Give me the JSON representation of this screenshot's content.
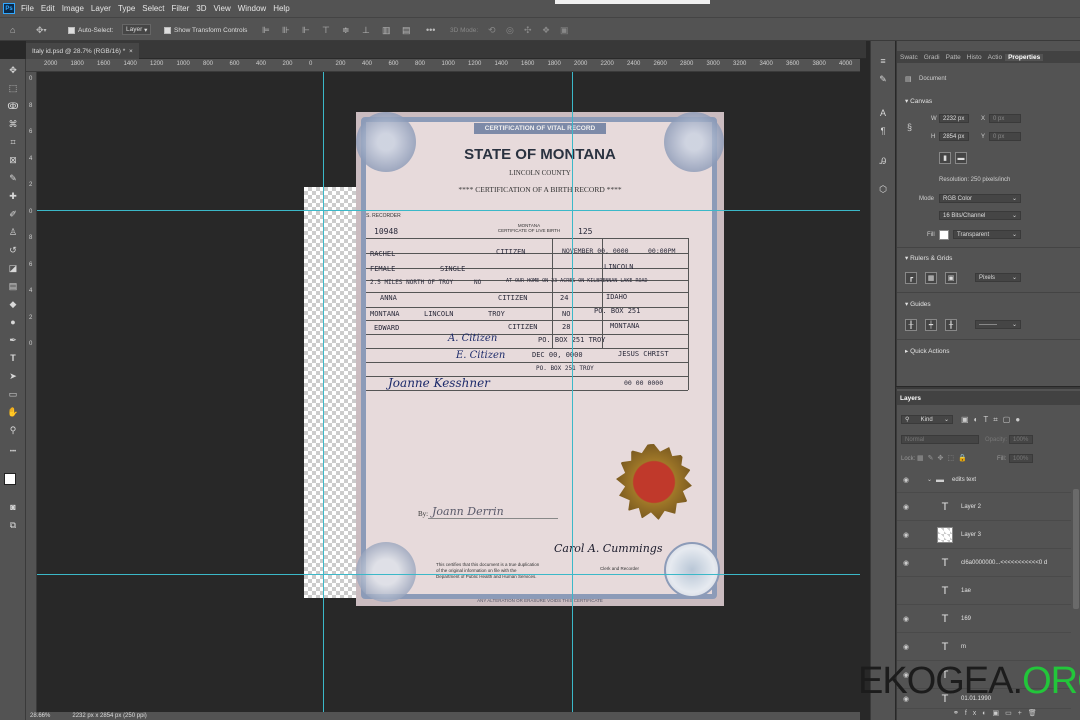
{
  "app": {
    "logo": "Ps"
  },
  "menu": [
    "File",
    "Edit",
    "Image",
    "Layer",
    "Type",
    "Select",
    "Filter",
    "3D",
    "View",
    "Window",
    "Help"
  ],
  "options": {
    "auto_select": "Auto-Select:",
    "auto_select_target": "Layer",
    "show_transform": "Show Transform Controls",
    "mode_3d": "3D Mode:"
  },
  "tab": {
    "title": "Italy id.psd @ 28.7% (RGB/16) *",
    "close": "×"
  },
  "ruler": {
    "h": [
      "2000",
      "1800",
      "1600",
      "1400",
      "1200",
      "1000",
      "800",
      "600",
      "400",
      "200",
      "0",
      "200",
      "400",
      "600",
      "800",
      "1000",
      "1200",
      "1400",
      "1600",
      "1800",
      "2000",
      "2200",
      "2400",
      "2600",
      "2800",
      "3000",
      "3200",
      "3400",
      "3600",
      "3800",
      "4000",
      "42"
    ],
    "v": [
      "0",
      "8",
      "6",
      "4",
      "2",
      "0",
      "8",
      "6",
      "4",
      "2",
      "0"
    ]
  },
  "status": {
    "zoom": "28.66%",
    "size": "2232 px x 2854 px (250 ppi)"
  },
  "document": {
    "band": "CERTIFICATION OF VITAL RECORD",
    "state": "STATE OF MONTANA",
    "county": "LINCOLN COUNTY",
    "type": "**** CERTIFICATION OF A BIRTH RECORD ****",
    "recorder": "S. RECORDER",
    "number": "10948",
    "center_head": "MONTANA\nCERTIFICATE OF LIVE BIRTH",
    "cert_no": "125",
    "first_name": "RACHEL",
    "surname": "CITIZEN",
    "birth_date": "NOVEMBER 00, 0000",
    "birth_time": "00:00PM",
    "sex": "FEMALE",
    "plurality": "SINGLE",
    "county_birth": "LINCOLN",
    "place": "2.5 MILES NORTH OF TROY",
    "inside": "NO",
    "place2": "AT OUR HOME ON 23 ACRES ON KILBRENNAN LAKE ROAD",
    "mother_first": "ANNA",
    "mother_last": "CITIZEN",
    "mother_age": "24",
    "mother_state": "IDAHO",
    "res_state": "MONTANA",
    "res_county": "LINCOLN",
    "res_city": "TROY",
    "res_inside": "NO",
    "res_box": "PO. BOX 251",
    "father_first": "EDWARD",
    "father_last": "CITIZEN",
    "father_age": "28",
    "father_state": "MONTANA",
    "informant_sig": "A. Citizen",
    "informant_addr": "PO. BOX 251 TROY",
    "cert_date": "DEC 00, 0000",
    "attendant": "JESUS CHRIST",
    "attendant_sig": "E. Citizen",
    "attendant_addr": "PO. BOX 251 TROY",
    "registrar_sig": "Joanne Kesshner",
    "filed_date": "00 00 0000",
    "by_label": "By:",
    "by_sig": "Joann Derrin",
    "footer1": "This certifies that this document is a true duplication",
    "footer2": "of the original information on file with the",
    "footer3": "Department of Public Health and Human Services.",
    "clerk_sig": "Carol A. Cummings",
    "clerk_title": "Clerk and Recorder",
    "bottom": "ANY ALTERATION OR ERASURE VOIDS THIS CERTIFICATE"
  },
  "right_panel": {
    "tabs": [
      "Swatc",
      "Gradi",
      "Patte",
      "Histo",
      "Actio",
      "Properties"
    ],
    "doc_label": "Document",
    "canvas_title": "Canvas",
    "w_label": "W",
    "w_value": "2232 px",
    "x_label": "X",
    "x_value": "0 px",
    "h_label": "H",
    "h_value": "2854 px",
    "y_label": "Y",
    "y_value": "0 px",
    "resolution": "Resolution: 250 pixels/inch",
    "mode_label": "Mode",
    "mode": "RGB Color",
    "depth": "16 Bits/Channel",
    "fill_label": "Fill",
    "fill": "Transparent",
    "rulers_title": "Rulers & Grids",
    "units": "Pixels",
    "guides_title": "Guides",
    "quick_actions": "Quick Actions"
  },
  "layers_panel": {
    "title": "Layers",
    "kind": "Kind",
    "blend": "Normal",
    "opacity_label": "Opacity:",
    "opacity": "100%",
    "lock_label": "Lock:",
    "fill_label": "Fill:",
    "fill": "100%",
    "layers": [
      {
        "name": "edits text",
        "kind": "group"
      },
      {
        "name": "Layer 2",
        "kind": "text"
      },
      {
        "name": "Layer 3",
        "kind": "image"
      },
      {
        "name": "cl6a0000000...<<<<<<<<<<<0 d",
        "kind": "text"
      },
      {
        "name": "1ae",
        "kind": "text"
      },
      {
        "name": "169",
        "kind": "text"
      },
      {
        "name": "m",
        "kind": "text"
      },
      {
        "name": "",
        "kind": "text"
      },
      {
        "name": "01.01.1990",
        "kind": "text"
      }
    ]
  },
  "watermark": {
    "main": "EKOGEA",
    "dot": ".",
    "suffix": "ORG"
  },
  "colors": {
    "accent": "#31a8ff",
    "guide": "#3bb8c8",
    "seal_gold": "#a07828",
    "seal_red": "#c0392b",
    "watermark_green": "#22c63a"
  }
}
